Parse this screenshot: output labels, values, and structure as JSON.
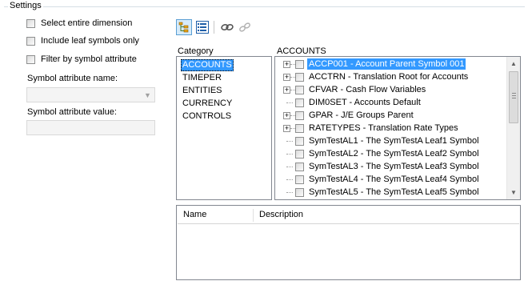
{
  "settings": {
    "title": "Settings"
  },
  "options": [
    {
      "label": "Select entire dimension"
    },
    {
      "label": "Include leaf symbols only"
    },
    {
      "label": "Filter by symbol attribute"
    }
  ],
  "attribute": {
    "name_label": "Symbol attribute name:",
    "name_value": "",
    "value_label": "Symbol attribute value:",
    "value_value": ""
  },
  "toolbar": {
    "buttons": [
      {
        "name": "tree-view-icon",
        "active": true
      },
      {
        "name": "list-view-icon",
        "active": false
      },
      {
        "name": "link-icon",
        "active": false
      },
      {
        "name": "unlink-icon",
        "active": false
      }
    ]
  },
  "category": {
    "header": "Category",
    "items": [
      "ACCOUNTS",
      "TIMEPER",
      "ENTITIES",
      "CURRENCY",
      "CONTROLS"
    ],
    "selected": "ACCOUNTS"
  },
  "tree": {
    "header": "ACCOUNTS",
    "rows": [
      {
        "label": "ACCP001 - Account Parent Symbol 001",
        "expandable": true,
        "selected": true
      },
      {
        "label": "ACCTRN - Translation Root for Accounts",
        "expandable": true,
        "selected": false
      },
      {
        "label": "CFVAR - Cash Flow Variables",
        "expandable": true,
        "selected": false
      },
      {
        "label": "DIM0SET - Accounts Default",
        "expandable": false,
        "selected": false
      },
      {
        "label": "GPAR - J/E Groups Parent",
        "expandable": true,
        "selected": false
      },
      {
        "label": "RATETYPES - Translation Rate Types",
        "expandable": true,
        "selected": false
      },
      {
        "label": "SymTestAL1 - The SymTestA Leaf1 Symbol",
        "expandable": false,
        "selected": false
      },
      {
        "label": "SymTestAL2 - The SymTestA Leaf2 Symbol",
        "expandable": false,
        "selected": false
      },
      {
        "label": "SymTestAL3 - The SymTestA Leaf3 Symbol",
        "expandable": false,
        "selected": false
      },
      {
        "label": "SymTestAL4 - The SymTestA Leaf4 Symbol",
        "expandable": false,
        "selected": false
      },
      {
        "label": "SymTestAL5 - The SymTestA Leaf5 Symbol",
        "expandable": false,
        "selected": false
      }
    ]
  },
  "grid": {
    "columns": [
      "Name",
      "Description"
    ]
  },
  "colors": {
    "selection": "#3399ff",
    "border": "#828790",
    "group_line": "#d5dfe5"
  }
}
